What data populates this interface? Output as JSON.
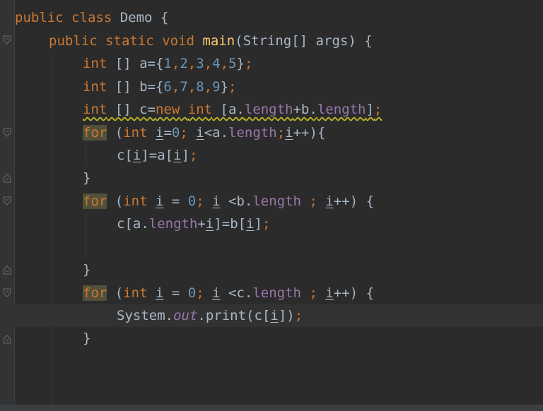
{
  "editor": {
    "theme_colors": {
      "background": "#2b2b2b",
      "text": "#a9b7c6",
      "keyword": "#cc7832",
      "number": "#6897bb",
      "method": "#ffc66d",
      "field": "#9876aa"
    },
    "lines": {
      "l1": {
        "t1": "public",
        "t2": " ",
        "t3": "class",
        "t4": " Demo {"
      },
      "l2": {
        "t1": "public",
        "t2": " ",
        "t3": "static",
        "t4": " ",
        "t5": "void",
        "t6": " ",
        "t7": "main",
        "t8": "(String[] args) {"
      },
      "l3": {
        "t1": "int",
        "t2": " [] a={",
        "n1": "1",
        "c1": ",",
        "n2": "2",
        "c2": ",",
        "n3": "3",
        "c3": ",",
        "n4": "4",
        "c4": ",",
        "n5": "5",
        "t3": "}",
        "s": ";"
      },
      "l4": {
        "t1": "int",
        "t2": " [] b={",
        "n1": "6",
        "c1": ",",
        "n2": "7",
        "c2": ",",
        "n3": "8",
        "c3": ",",
        "n4": "9",
        "t3": "}",
        "s": ";"
      },
      "l5": {
        "t1": "int",
        "t2": " [] c=",
        "t3": "new",
        "t4": " ",
        "t5": "int",
        "t6": " [a.",
        "f1": "length",
        "t7": "+b.",
        "f2": "length",
        "t8": "]",
        "s": ";"
      },
      "l6": {
        "t1": "for",
        "t2": " (",
        "t3": "int",
        "t4": " ",
        "v1": "i",
        "t5": "=",
        "n1": "0",
        "s1": ";",
        "t6": " ",
        "v2": "i",
        "t7": "<a.",
        "f1": "length",
        "s2": ";",
        "v3": "i",
        "t8": "++){"
      },
      "l7": {
        "t1": "c[",
        "v1": "i",
        "t2": "]=a[",
        "v2": "i",
        "t3": "]",
        "s": ";"
      },
      "l8": {
        "t1": "}"
      },
      "l9": {
        "t1": "for",
        "t2": " (",
        "t3": "int",
        "t4": " ",
        "v1": "i",
        "t5": " = ",
        "n1": "0",
        "s1": ";",
        "t6": " ",
        "v2": "i",
        "t7": " <b.",
        "f1": "length",
        "t8": " ",
        "s2": ";",
        "t9": " ",
        "v3": "i",
        "t10": "++) {"
      },
      "l10": {
        "t1": "c[a.",
        "f1": "length",
        "t2": "+",
        "v1": "i",
        "t3": "]=b[",
        "v2": "i",
        "t4": "]",
        "s": ";"
      },
      "l11": {
        "t1": "}"
      },
      "l12": {
        "t1": "for",
        "t2": " (",
        "t3": "int",
        "t4": " ",
        "v1": "i",
        "t5": " = ",
        "n1": "0",
        "s1": ";",
        "t6": " ",
        "v2": "i",
        "t7": " <c.",
        "f1": "length",
        "t8": " ",
        "s2": ";",
        "t9": " ",
        "v3": "i",
        "t10": "++) {"
      },
      "l13": {
        "t1": "System.",
        "f1": "out",
        "t2": ".print(c[",
        "v1": "i",
        "t3": "])",
        "s": ";"
      },
      "l14": {
        "t1": "}"
      }
    }
  }
}
